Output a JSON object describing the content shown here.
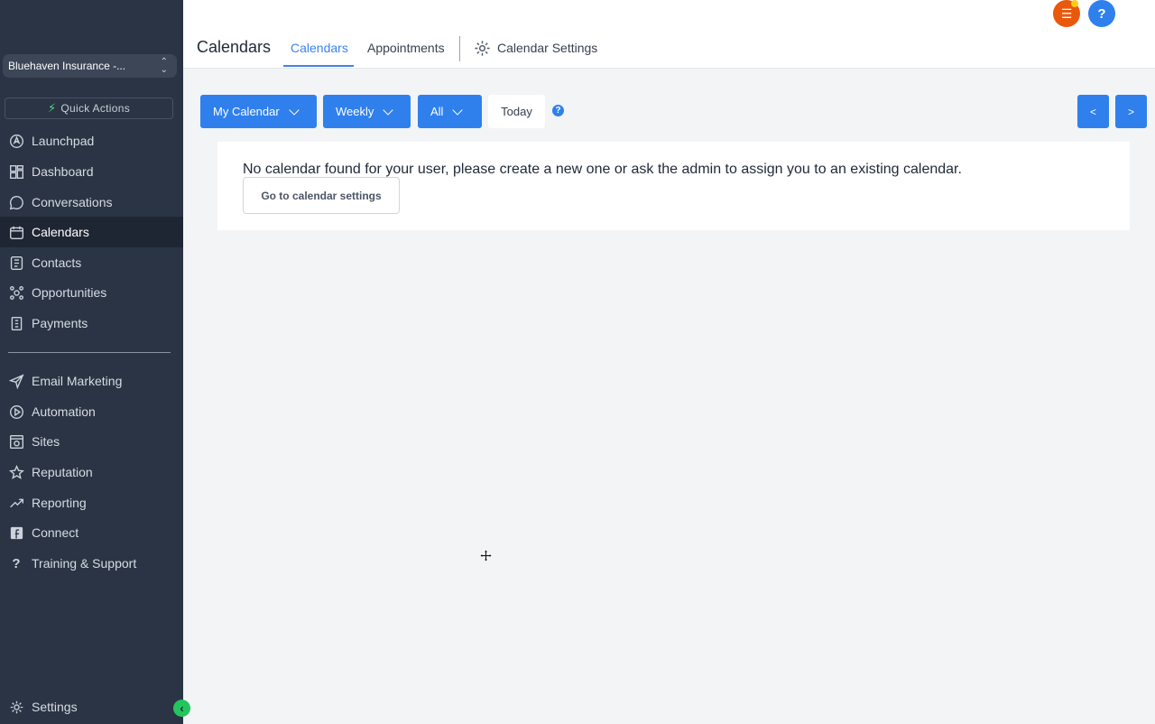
{
  "sidebar": {
    "account": "Bluehaven Insurance -...",
    "quick_actions": "Quick Actions",
    "items": [
      {
        "label": "Launchpad",
        "icon": "rocket-icon"
      },
      {
        "label": "Dashboard",
        "icon": "grid-icon"
      },
      {
        "label": "Conversations",
        "icon": "chat-icon"
      },
      {
        "label": "Calendars",
        "icon": "calendar-icon",
        "active": true
      },
      {
        "label": "Contacts",
        "icon": "contacts-icon"
      },
      {
        "label": "Opportunities",
        "icon": "opportunities-icon"
      },
      {
        "label": "Payments",
        "icon": "payments-icon"
      },
      {
        "label": "Email Marketing",
        "icon": "send-icon"
      },
      {
        "label": "Automation",
        "icon": "automation-icon"
      },
      {
        "label": "Sites",
        "icon": "sites-icon"
      },
      {
        "label": "Reputation",
        "icon": "star-icon"
      },
      {
        "label": "Reporting",
        "icon": "trend-icon"
      },
      {
        "label": "Connect",
        "icon": "facebook-icon"
      },
      {
        "label": "Training & Support",
        "icon": "question-icon"
      }
    ],
    "settings": "Settings"
  },
  "header": {
    "title": "Calendars",
    "tabs": [
      {
        "label": "Calendars",
        "active": true
      },
      {
        "label": "Appointments",
        "active": false
      },
      {
        "label": "Calendar Settings",
        "active": false
      }
    ],
    "help_label": "?"
  },
  "toolbar": {
    "calendar_select": "My Calendar",
    "view_select": "Weekly",
    "filter_select": "All",
    "today": "Today",
    "help": "?",
    "prev": "<",
    "next": ">"
  },
  "main": {
    "empty_message": "No calendar found for your user, please create a new one or ask the admin to assign you to an existing calendar.",
    "settings_button": "Go to calendar settings"
  },
  "colors": {
    "sidebar_bg": "#2a3444",
    "primary": "#2f80ed",
    "accent_orange": "#ea580c",
    "accent_green": "#22c55e"
  }
}
